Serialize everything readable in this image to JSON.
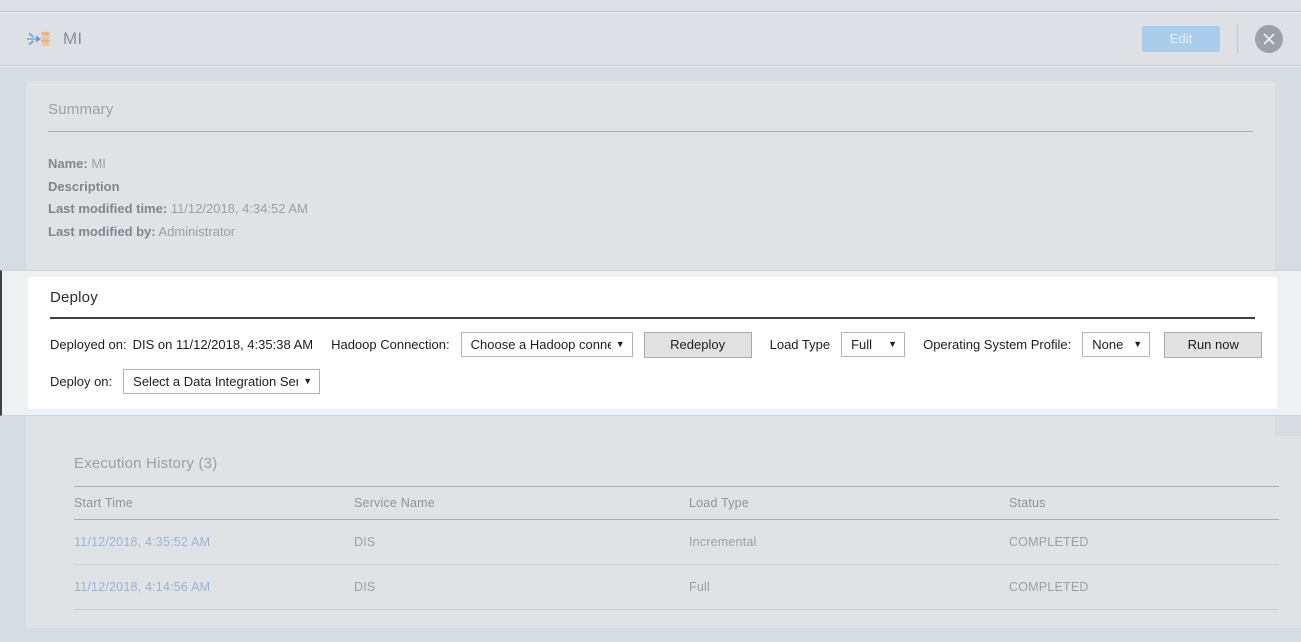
{
  "header": {
    "icon": "mapping-icon",
    "title": "MI",
    "edit_label": "Edit",
    "close_icon": "close-icon"
  },
  "summary": {
    "title": "Summary",
    "fields": [
      {
        "key": "Name:",
        "value": "MI"
      },
      {
        "key": "Description",
        "value": ""
      },
      {
        "key": "Last modified time:",
        "value": "11/12/2018, 4:34:52 AM"
      },
      {
        "key": "Last modified by:",
        "value": "Administrator"
      }
    ]
  },
  "deploy": {
    "title": "Deploy",
    "deployed_on_label": "Deployed on:",
    "deployed_on_value": "DIS on 11/12/2018, 4:35:38 AM",
    "hadoop_connection_label": "Hadoop Connection:",
    "hadoop_connection_value": "Choose a Hadoop conne",
    "redeploy_label": "Redeploy",
    "load_type_label": "Load Type",
    "load_type_value": "Full",
    "os_profile_label": "Operating System Profile:",
    "os_profile_value": "None",
    "run_now_label": "Run now",
    "deploy_on_label": "Deploy on:",
    "deploy_on_value": "Select a Data Integration Servi",
    "carat": "▼"
  },
  "execution_history": {
    "title": "Execution History (3)",
    "columns": [
      "Start Time",
      "Service Name",
      "Load Type",
      "Status"
    ],
    "rows": [
      {
        "start_time": "11/12/2018, 4:35:52 AM",
        "service_name": "DIS",
        "load_type": "Incremental",
        "status": "COMPLETED"
      },
      {
        "start_time": "11/12/2018, 4:14:56 AM",
        "service_name": "DIS",
        "load_type": "Full",
        "status": "COMPLETED"
      }
    ]
  },
  "colors": {
    "edit_button": "#a9cdea",
    "link_text": "#9ab4d4",
    "header_bg": "#dde1e5",
    "body_bg": "#d6dce0",
    "panel_bg": "#dfe3e6",
    "deploy_bg": "#ffffff",
    "deploy_border": "#3f3f3f"
  }
}
